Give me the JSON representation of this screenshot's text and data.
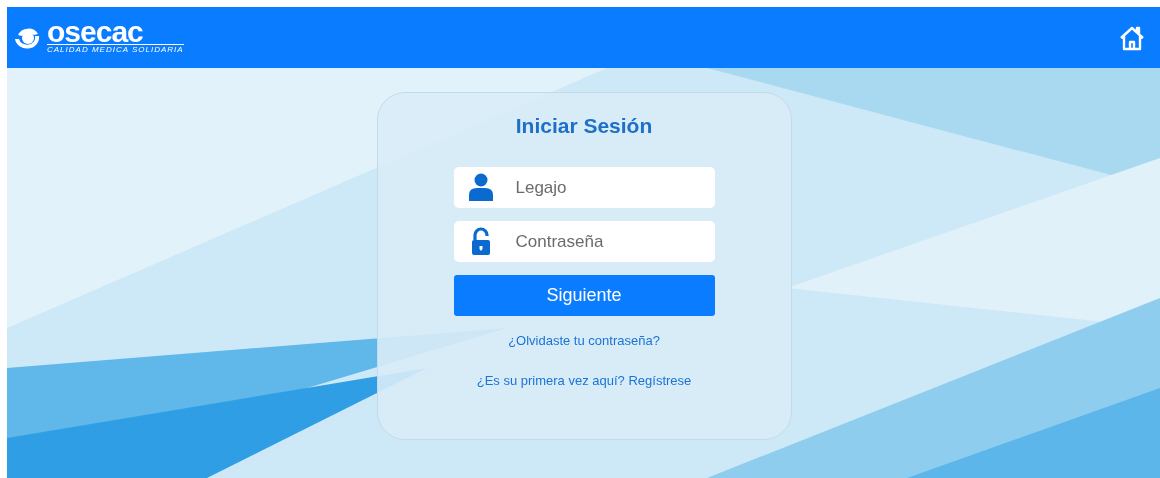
{
  "header": {
    "logo": {
      "name": "osecac",
      "tagline": "CALIDAD MEDICA SOLIDARIA"
    }
  },
  "login": {
    "title": "Iniciar Sesión",
    "fields": [
      {
        "kind": "user",
        "placeholder": "Legajo"
      },
      {
        "kind": "password",
        "placeholder": "Contraseña"
      }
    ],
    "submit": "Siguiente",
    "links": [
      "¿Olvidaste tu contraseña?",
      "¿Es su primera vez aquí? Regístrese"
    ]
  }
}
